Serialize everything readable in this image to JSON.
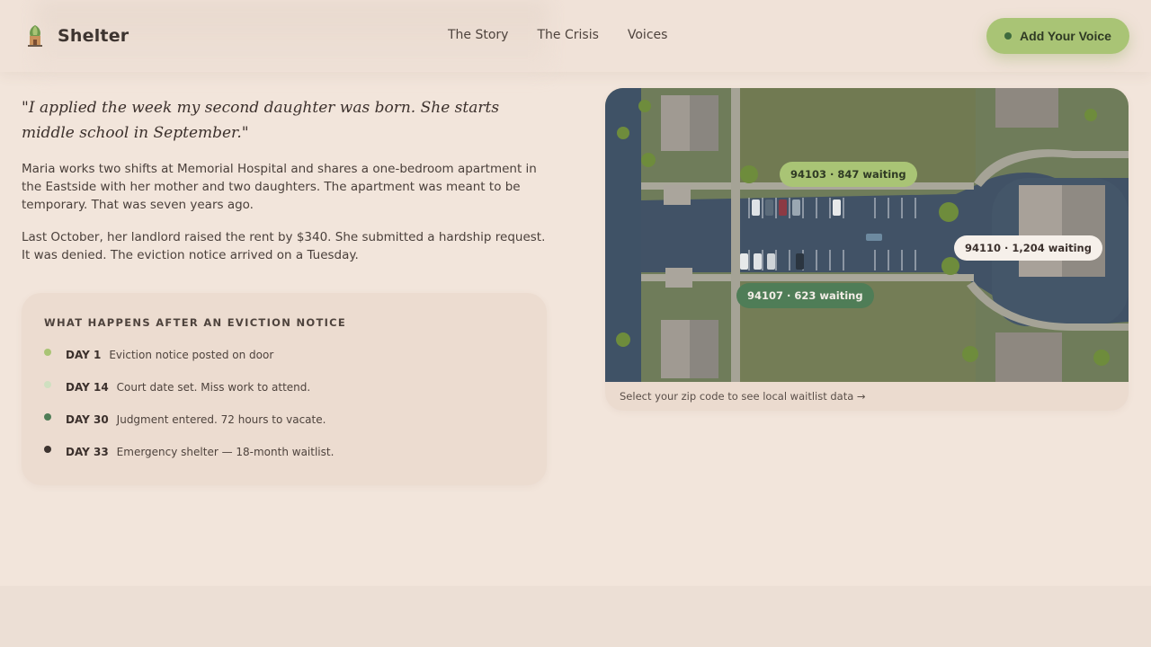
{
  "brand": {
    "name": "Shelter",
    "logo_icon": "tree-house-icon"
  },
  "nav": {
    "items": [
      "The Story",
      "The Crisis",
      "Voices"
    ]
  },
  "cta": {
    "label": "Add Your Voice",
    "dot_color": "#3e6b3e",
    "bg_color": "#a9c475"
  },
  "story": {
    "quote": "\"I applied the week my second daughter was born. She starts middle school in September.\"",
    "paragraphs": [
      "Maria works two shifts at Memorial Hospital and shares a one-bedroom apartment in the Eastside with her mother and two daughters. The apartment was meant to be temporary. That was seven years ago.",
      "Last October, her landlord raised the rent by $340. She submitted a hardship request. It was denied. The eviction notice arrived on a Tuesday."
    ]
  },
  "timeline": {
    "title": "WHAT HAPPENS AFTER AN EVICTION NOTICE",
    "items": [
      {
        "day": "DAY 1",
        "text": "Eviction notice posted on door",
        "color": "#a9c475"
      },
      {
        "day": "DAY 14",
        "text": "Court date set. Miss work to attend.",
        "color": "#cfe0c0"
      },
      {
        "day": "DAY 30",
        "text": "Judgment entered. 72 hours to vacate.",
        "color": "#4f7d57"
      },
      {
        "day": "DAY 33",
        "text": "Emergency shelter — 18-month waitlist.",
        "color": "#3d3430"
      }
    ]
  },
  "map": {
    "pins": [
      {
        "label": "94103 · 847 waiting"
      },
      {
        "label": "94110 · 1,204 waiting"
      },
      {
        "label": "94107 · 623 waiting"
      }
    ],
    "caption": "Select your zip code to see local waitlist data →"
  }
}
